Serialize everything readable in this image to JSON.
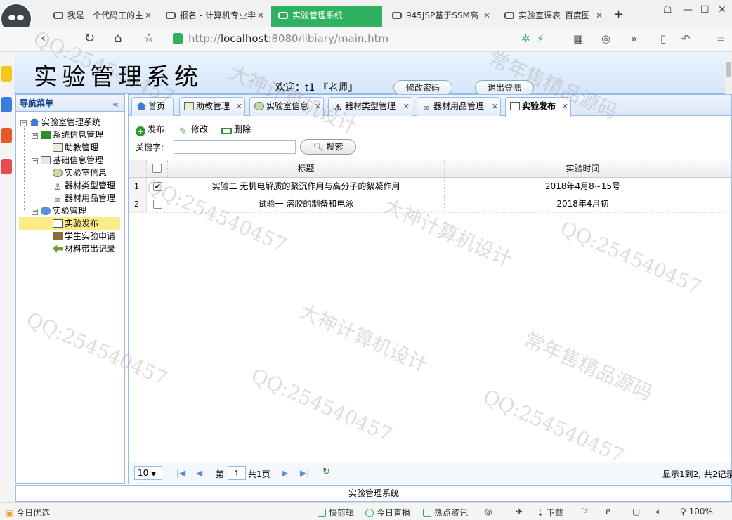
{
  "browser": {
    "tabs": [
      {
        "label": "我是一个代码工的主",
        "active": false
      },
      {
        "label": "报名 - 计算机专业毕",
        "active": false
      },
      {
        "label": "实验管理系统",
        "active": true
      },
      {
        "label": "945JSP基于SSM高",
        "active": false
      },
      {
        "label": "实验室课表_百度图",
        "active": false
      }
    ],
    "new_tab": "+",
    "url_prefix": "http://",
    "url_host": "localhost",
    "url_rest": ":8080/libiary/main.htm"
  },
  "header": {
    "title": "实验管理系统",
    "welcome": "欢迎：t1 『老师』",
    "change_password": "修改密码",
    "logout": "退出登陆"
  },
  "nav": {
    "title": "导航菜单",
    "collapse": "«",
    "tree": [
      {
        "label": "实验室管理系统",
        "level": 0,
        "icon": "home-icon"
      },
      {
        "label": "系统信息管理",
        "level": 1,
        "icon": "folder-green-icon"
      },
      {
        "label": "助教管理",
        "level": 2,
        "icon": "grid-icon"
      },
      {
        "label": "基础信息管理",
        "level": 1,
        "icon": "doc-icon"
      },
      {
        "label": "实验室信息",
        "level": 2,
        "icon": "globe-icon"
      },
      {
        "label": "器材类型管理",
        "level": 2,
        "icon": "anchor-icon"
      },
      {
        "label": "器材用品管理",
        "level": 2,
        "icon": "link-icon"
      },
      {
        "label": "实验管理",
        "level": 1,
        "icon": "bubble-icon"
      },
      {
        "label": "实验发布",
        "level": 2,
        "icon": "page-icon",
        "selected": true
      },
      {
        "label": "学生实验申请",
        "level": 2,
        "icon": "box-icon"
      },
      {
        "label": "材料带出记录",
        "level": 2,
        "icon": "arrow-left-icon"
      }
    ]
  },
  "panel_tabs": [
    {
      "label": "首页",
      "icon": "home-icon",
      "closable": false
    },
    {
      "label": "助教管理",
      "icon": "grid-icon",
      "closable": true
    },
    {
      "label": "实验室信息",
      "icon": "globe-icon",
      "closable": true
    },
    {
      "label": "器材类型管理",
      "icon": "anchor-icon",
      "closable": true
    },
    {
      "label": "器材用品管理",
      "icon": "link-icon",
      "closable": true
    },
    {
      "label": "实验发布",
      "icon": "page-icon",
      "closable": true,
      "active": true
    }
  ],
  "toolbar": {
    "publish": "发布",
    "edit": "修改",
    "delete": "删除",
    "keyword_label": "关键字:",
    "keyword_value": "",
    "search": "搜索"
  },
  "table": {
    "columns": [
      "标题",
      "实验时间"
    ],
    "rows": [
      {
        "n": "1",
        "checked": true,
        "title": "实验二 无机电解质的聚沉作用与高分子的絮凝作用",
        "time": "2018年4月8~15号"
      },
      {
        "n": "2",
        "checked": false,
        "title": "试验一 溶胶的制备和电泳",
        "time": "2018年4月初"
      }
    ]
  },
  "pager": {
    "page_size": "10",
    "page_prefix": "第",
    "page_value": "1",
    "page_total": "共1页",
    "summary": "显示1到2, 共2记录"
  },
  "footer": "实验管理系统",
  "status_bar": {
    "left": "今日优选",
    "items": [
      "快剪辑",
      "今日直播",
      "热点资讯",
      "下载",
      "100%"
    ]
  },
  "watermarks": [
    "QQ:254540457",
    "大神计算机设计",
    "常年售精品源码"
  ]
}
